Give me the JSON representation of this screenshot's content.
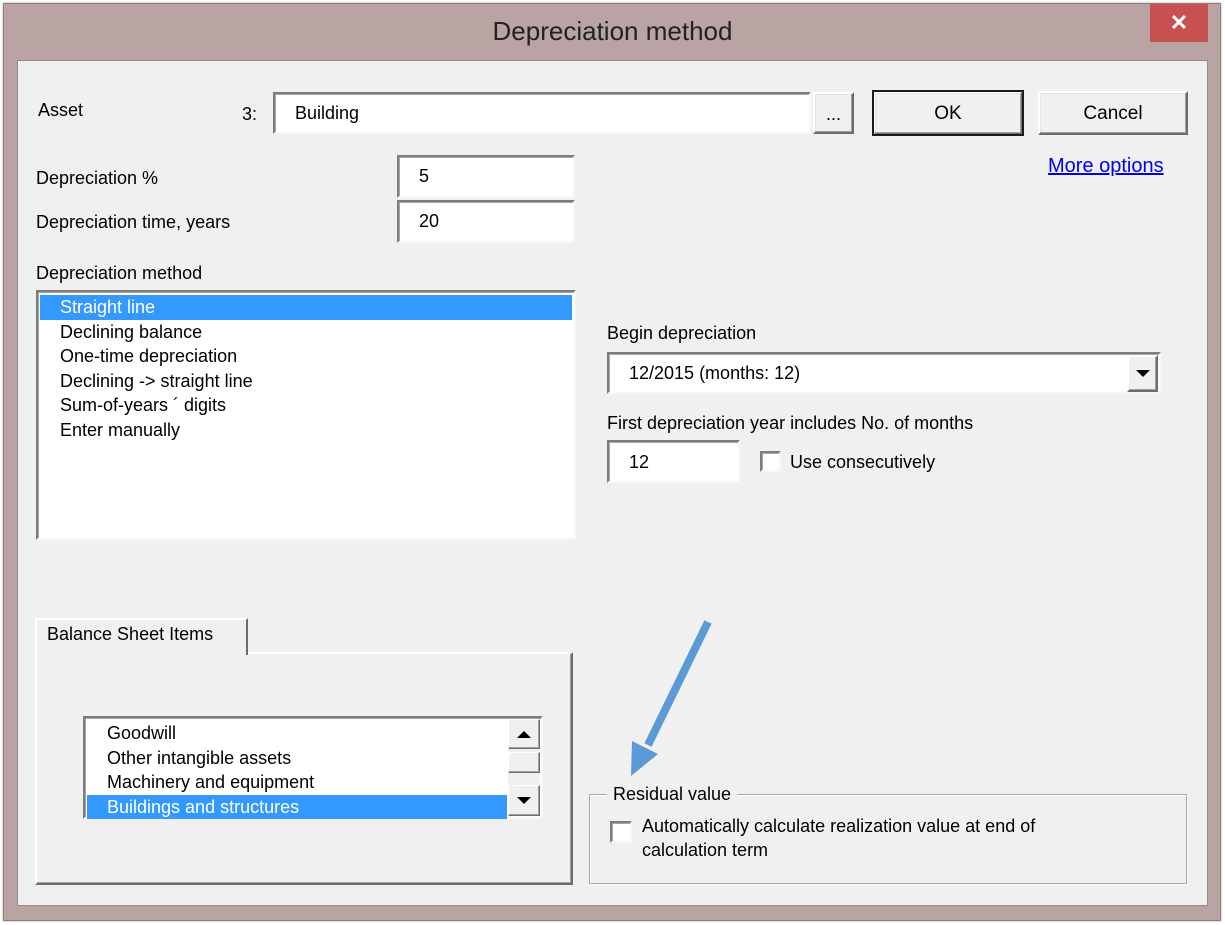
{
  "window": {
    "title": "Depreciation method",
    "close_label": "✕"
  },
  "asset": {
    "label": "Asset",
    "number": "3:",
    "value": "Building",
    "browse_label": "..."
  },
  "buttons": {
    "ok": "OK",
    "cancel": "Cancel"
  },
  "more_options_link": "More options",
  "depreciation_percent": {
    "label": "Depreciation %",
    "value": "5"
  },
  "depreciation_years": {
    "label": "Depreciation time, years",
    "value": "20"
  },
  "method": {
    "label": "Depreciation method",
    "options": [
      "Straight line",
      "Declining balance",
      "One-time depreciation",
      "Declining -> straight line",
      "Sum-of-years ´ digits",
      "Enter manually"
    ],
    "selected_index": 0
  },
  "begin_depreciation": {
    "label": "Begin depreciation",
    "value": "12/2015 (months: 12)"
  },
  "first_year": {
    "label": "First depreciation year includes No. of months",
    "value": "12",
    "use_consecutively_label": "Use consecutively",
    "use_consecutively_checked": false
  },
  "balance_sheet": {
    "tab_label": "Balance Sheet Items",
    "items": [
      "Goodwill",
      "Other intangible assets",
      "Machinery and equipment",
      "Buildings and structures"
    ],
    "selected_index": 3
  },
  "residual_value": {
    "group_label": "Residual value",
    "checkbox_label": "Automatically calculate realization value at end of calculation term",
    "checked": false
  },
  "annotation": {
    "type": "arrow",
    "points_to": "residual-value-group",
    "color": "#5b9bd5"
  },
  "colors": {
    "frame": "#b9a3a3",
    "close_button": "#c75050",
    "selection": "#3399ff",
    "link": "#0000ee",
    "client_background": "#f0f0f0"
  }
}
